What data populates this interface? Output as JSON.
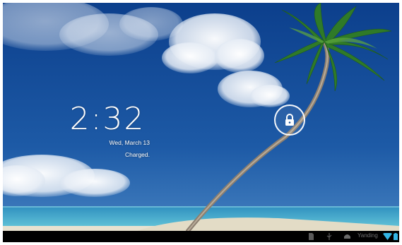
{
  "lockscreen": {
    "time": "2:32",
    "date": "Wed, March 13",
    "status": "Charged."
  },
  "status_bar": {
    "carrier": "Yanding",
    "icons": [
      "sd-card-icon",
      "usb-icon",
      "android-debug-icon",
      "wifi-icon",
      "battery-icon"
    ]
  },
  "colors": {
    "sky_top": "#0c3f8c",
    "sky_bottom": "#2f6bb3",
    "sea": "#3b9fc3",
    "sand": "#e8e2d0",
    "accent_wifi": "#33b5e5"
  }
}
